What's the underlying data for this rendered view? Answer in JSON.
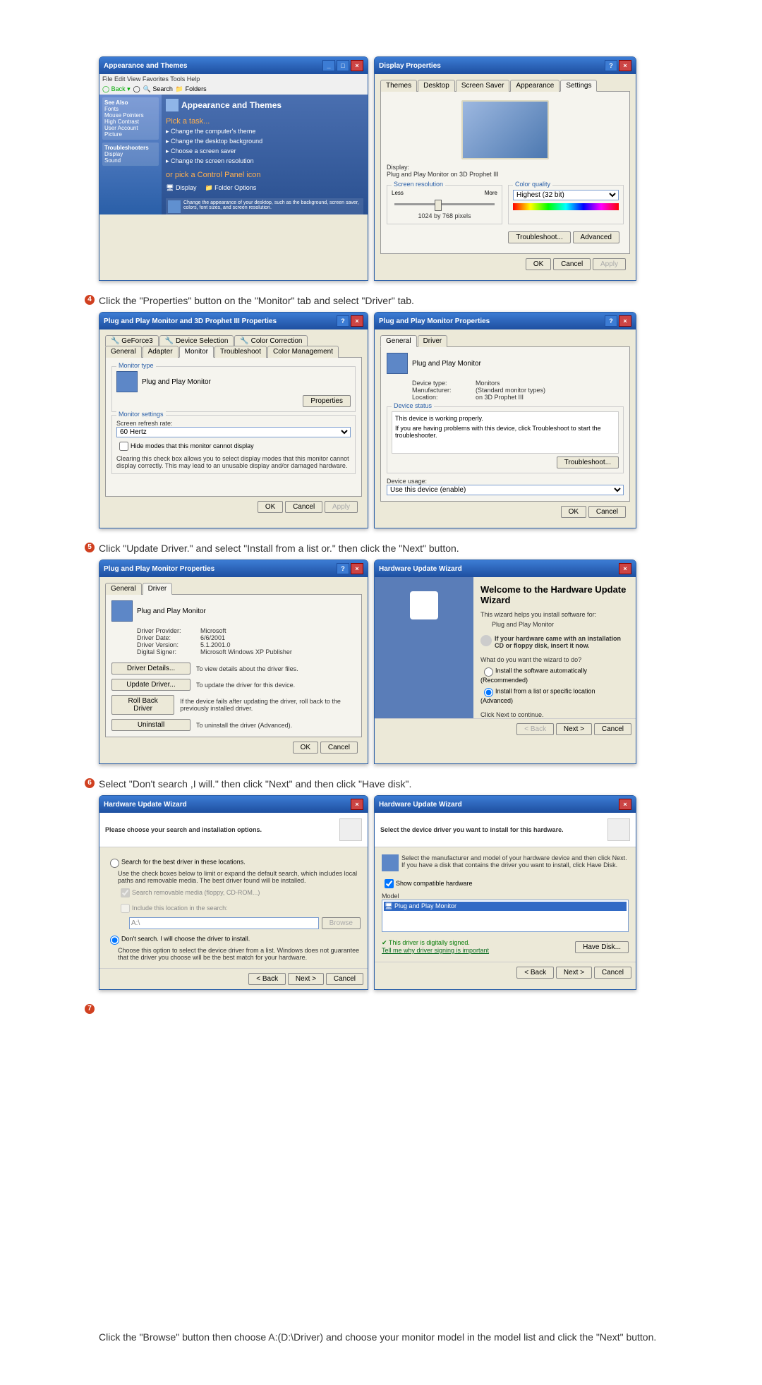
{
  "section1": {
    "cp_title": "Appearance and Themes",
    "cp_heading": "Appearance and Themes",
    "pick_task": "Pick a task...",
    "task1": "Change the computer's theme",
    "task2": "Change the desktop background",
    "task3": "Choose a screen saver",
    "task4": "Change the screen resolution",
    "or_pick": "or pick a Control Panel icon",
    "icon_display": "Display",
    "icon_folder": "Folder Options",
    "cp_hint": "Change the appearance of your desktop, such as the background, screen saver, colors, font sizes, and screen resolution.",
    "see_also": "See Also",
    "sa1": "Fonts",
    "sa2": "Mouse Pointers",
    "sa3": "High Contrast",
    "sa4": "User Account Picture",
    "troubleshoot": "Troubleshooters",
    "ts1": "Display",
    "ts2": "Sound",
    "dp_title": "Display Properties",
    "tab_themes": "Themes",
    "tab_desktop": "Desktop",
    "tab_ss": "Screen Saver",
    "tab_app": "Appearance",
    "tab_settings": "Settings",
    "display_label": "Display:",
    "display_value": "Plug and Play Monitor on 3D Prophet III",
    "res_label": "Screen resolution",
    "less": "Less",
    "more": "More",
    "res_value": "1024 by 768 pixels",
    "cq_label": "Color quality",
    "cq_value": "Highest (32 bit)",
    "btn_trouble": "Troubleshoot...",
    "btn_adv": "Advanced",
    "ok": "OK",
    "cancel": "Cancel",
    "apply": "Apply"
  },
  "step4": {
    "text": "Click the \"Properties\" button on the \"Monitor\" tab and select \"Driver\" tab.",
    "left_title": "Plug and Play Monitor and 3D Prophet III Properties",
    "tab_gf": "GeForce3",
    "tab_ds": "Device Selection",
    "tab_cc": "Color Correction",
    "tab_gen": "General",
    "tab_adp": "Adapter",
    "tab_mon": "Monitor",
    "tab_tr": "Troubleshoot",
    "tab_cm": "Color Management",
    "mon_type": "Monitor type",
    "mon_name": "Plug and Play Monitor",
    "btn_prop": "Properties",
    "mon_settings": "Monitor settings",
    "srr": "Screen refresh rate:",
    "hz": "60 Hertz",
    "hide": "Hide modes that this monitor cannot display",
    "hide_note": "Clearing this check box allows you to select display modes that this monitor cannot display correctly. This may lead to an unusable display and/or damaged hardware.",
    "right_title": "Plug and Play Monitor Properties",
    "r_tab_gen": "General",
    "r_tab_drv": "Driver",
    "r_mon": "Plug and Play Monitor",
    "dtype_l": "Device type:",
    "dtype_v": "Monitors",
    "manu_l": "Manufacturer:",
    "manu_v": "(Standard monitor types)",
    "loc_l": "Location:",
    "loc_v": "on 3D Prophet III",
    "dstatus": "Device status",
    "dstatus_v": "This device is working properly.",
    "dstatus_note": "If you are having problems with this device, click Troubleshoot to start the troubleshooter.",
    "btn_ts": "Troubleshoot...",
    "dusage": "Device usage:",
    "dusage_v": "Use this device (enable)",
    "ok": "OK",
    "cancel": "Cancel",
    "apply": "Apply"
  },
  "step5": {
    "text": "Click \"Update Driver.\" and select \"Install from a list or.\" then click the \"Next\" button.",
    "left_title": "Plug and Play Monitor Properties",
    "tab_gen": "General",
    "tab_drv": "Driver",
    "mon": "Plug and Play Monitor",
    "dp_l": "Driver Provider:",
    "dp_v": "Microsoft",
    "dd_l": "Driver Date:",
    "dd_v": "6/6/2001",
    "dv_l": "Driver Version:",
    "dv_v": "5.1.2001.0",
    "ds_l": "Digital Signer:",
    "ds_v": "Microsoft Windows XP Publisher",
    "btn_details": "Driver Details...",
    "details_d": "To view details about the driver files.",
    "btn_update": "Update Driver...",
    "update_d": "To update the driver for this device.",
    "btn_roll": "Roll Back Driver",
    "roll_d": "If the device fails after updating the driver, roll back to the previously installed driver.",
    "btn_uninstall": "Uninstall",
    "uninstall_d": "To uninstall the driver (Advanced).",
    "right_title": "Hardware Update Wizard",
    "welcome": "Welcome to the Hardware Update Wizard",
    "helps": "This wizard helps you install software for:",
    "pnp": "Plug and Play Monitor",
    "cd_note": "If your hardware came with an installation CD or floppy disk, insert it now.",
    "what": "What do you want the wizard to do?",
    "opt1": "Install the software automatically (Recommended)",
    "opt2": "Install from a list or specific location (Advanced)",
    "click_next": "Click Next to continue.",
    "back": "< Back",
    "next": "Next >",
    "cancel": "Cancel",
    "ok": "OK"
  },
  "step6": {
    "text": "Select \"Don't search ,I will.\" then click \"Next\" and then click \"Have disk\".",
    "title": "Hardware Update Wizard",
    "left_head": "Please choose your search and installation options.",
    "opt_search": "Search for the best driver in these locations.",
    "search_note": "Use the check boxes below to limit or expand the default search, which includes local paths and removable media. The best driver found will be installed.",
    "chk1": "Search removable media (floppy, CD-ROM...)",
    "chk2": "Include this location in the search:",
    "path": "A:\\",
    "browse": "Browse",
    "opt_dont": "Don't search. I will choose the driver to install.",
    "dont_note": "Choose this option to select the device driver from a list. Windows does not guarantee that the driver you choose will be the best match for your hardware.",
    "right_head": "Select the device driver you want to install for this hardware.",
    "right_note": "Select the manufacturer and model of your hardware device and then click Next. If you have a disk that contains the driver you want to install, click Have Disk.",
    "show_compat": "Show compatible hardware",
    "model": "Model",
    "pnp": "Plug and Play Monitor",
    "signed": "This driver is digitally signed.",
    "tell": "Tell me why driver signing is important",
    "have_disk": "Have Disk...",
    "back": "< Back",
    "next": "Next >",
    "cancel": "Cancel"
  },
  "step7": {
    "text": "Click the \"Browse\" button then choose A:(D:\\Driver) and choose your monitor model in the model list and click the \"Next\" button."
  }
}
